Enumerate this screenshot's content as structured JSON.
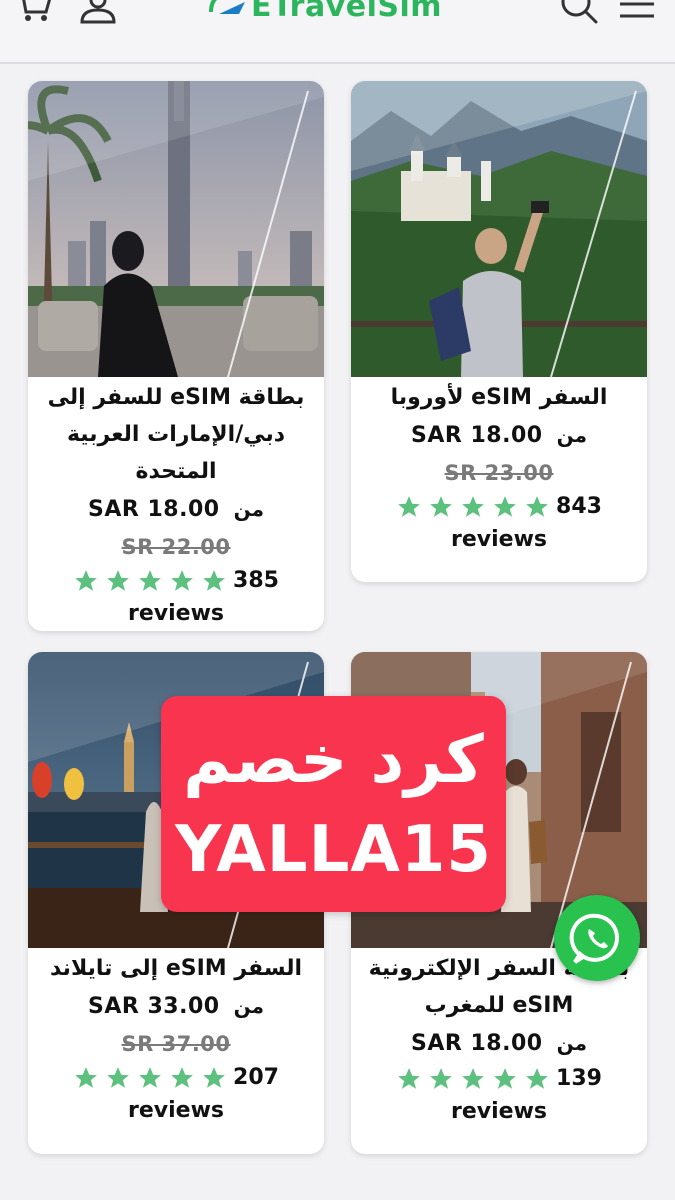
{
  "header": {
    "logo_text": "ETravelSim",
    "icons": [
      "cart-icon",
      "user-icon",
      "search-icon",
      "menu-icon"
    ]
  },
  "products": [
    {
      "title": "بطاقة eSIM للسفر إلى دبي/الإمارات العربية المتحدة",
      "from_label": "من",
      "price": "SAR 18.00",
      "old_price": "SR 22.00",
      "rating_stars": 5,
      "review_count": "385",
      "reviews_label": "reviews"
    },
    {
      "title": "السفر eSIM لأوروبا",
      "from_label": "من",
      "price": "SAR 18.00",
      "old_price": "SR 23.00",
      "rating_stars": 5,
      "review_count": "843",
      "reviews_label": "reviews"
    },
    {
      "title": "السفر eSIM إلى تايلاند",
      "from_label": "من",
      "price": "SAR 33.00",
      "old_price": "SR 37.00",
      "rating_stars": 5,
      "review_count": "207",
      "reviews_label": "reviews"
    },
    {
      "title": "بطاقة السفر الإلكترونية eSIM للمغرب",
      "from_label": "من",
      "price": "SAR 18.00",
      "old_price": "",
      "rating_stars": 5,
      "review_count": "139",
      "reviews_label": "reviews"
    }
  ],
  "promo": {
    "line1": "كرد خصم",
    "line2": "YALLA15"
  },
  "colors": {
    "brand_green": "#2db55d",
    "star_green": "#5ec07e",
    "promo_red": "#f8344f",
    "whatsapp_green": "#29c24f"
  }
}
